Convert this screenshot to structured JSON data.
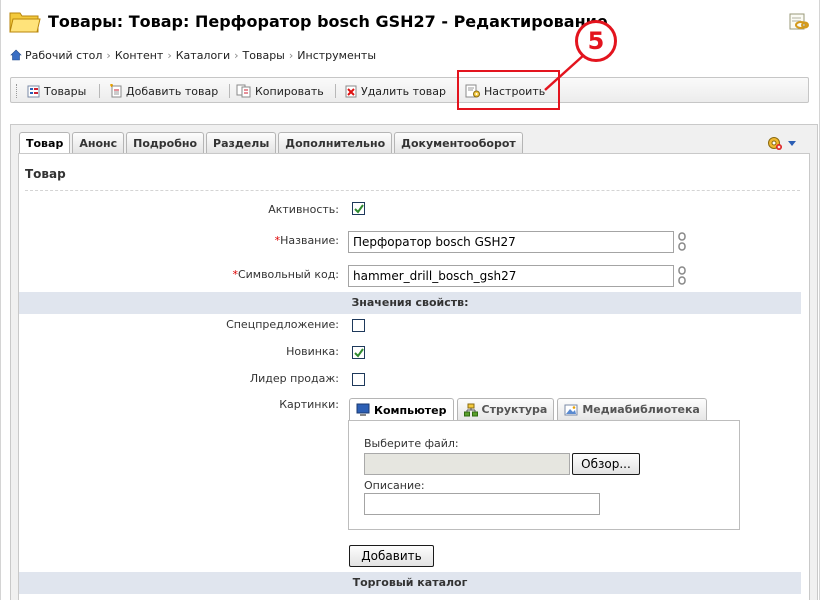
{
  "header": {
    "title": "Товары: Товар: Перфоратор bosch GSH27 - Редактирование"
  },
  "breadcrumb": [
    "Рабочий стол",
    "Контент",
    "Каталоги",
    "Товары",
    "Инструменты"
  ],
  "toolbar": {
    "items": [
      "Товары",
      "Добавить товар",
      "Копировать",
      "Удалить товар",
      "Настроить"
    ]
  },
  "callout": {
    "number": "5",
    "color": "#e3141e"
  },
  "tabs": [
    "Товар",
    "Анонс",
    "Подробно",
    "Разделы",
    "Дополнительно",
    "Документооборот"
  ],
  "section": {
    "title": "Товар"
  },
  "fields": {
    "active": {
      "label": "Активность:",
      "checked": true
    },
    "name": {
      "label": "Название:",
      "value": "Перфоратор bosch GSH27"
    },
    "code": {
      "label": "Символьный код:",
      "value": "hammer_drill_bosch_gsh27"
    }
  },
  "properties_header": "Значения свойств:",
  "properties": {
    "special": {
      "label": "Спецпредложение:",
      "checked": false
    },
    "new": {
      "label": "Новинка:",
      "checked": true
    },
    "leader": {
      "label": "Лидер продаж:",
      "checked": false
    }
  },
  "images": {
    "label": "Картинки:",
    "tabs": [
      "Компьютер",
      "Структура",
      "Медиабиблиотека"
    ],
    "choose_file_label": "Выберите файл:",
    "browse_button": "Обзор...",
    "description_label": "Описание:",
    "file_value": "",
    "description_value": ""
  },
  "add_button": "Добавить",
  "catalog_header": "Торговый каталог",
  "colors": {
    "accent": "#e3141e",
    "band": "#e0e5ee",
    "check": "#2f8a2f"
  }
}
